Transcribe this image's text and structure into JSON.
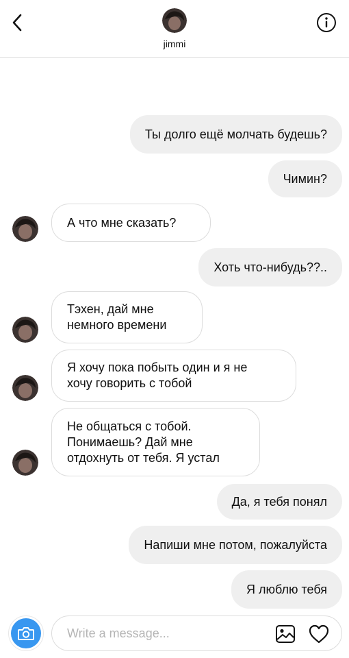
{
  "header": {
    "username": "jimmi",
    "back_icon": "chevron-left-icon",
    "info_icon": "info-icon"
  },
  "messages": [
    {
      "direction": "out",
      "text": "Ты долго ещё молчать будешь?"
    },
    {
      "direction": "out",
      "text": "Чимин?"
    },
    {
      "direction": "in",
      "text": "А что мне сказать?"
    },
    {
      "direction": "out",
      "text": "Хоть что-нибудь??.."
    },
    {
      "direction": "in",
      "text": "Тэхен, дай мне\nнемного времени"
    },
    {
      "direction": "in",
      "text": "Я хочу пока побыть один и я не\nхочу говорить с тобой"
    },
    {
      "direction": "in",
      "text": "Не общаться с тобой.\nПонимаешь? Дай мне\nотдохнуть от тебя. Я устал"
    },
    {
      "direction": "out",
      "text": "Да, я тебя понял"
    },
    {
      "direction": "out",
      "text": "Напиши мне потом, пожалуйста"
    },
    {
      "direction": "out",
      "text": "Я люблю тебя"
    }
  ],
  "composer": {
    "placeholder": "Write a message...",
    "camera_icon": "camera-icon",
    "gallery_icon": "gallery-icon",
    "heart_icon": "heart-icon",
    "accent_color": "#3897f0"
  }
}
